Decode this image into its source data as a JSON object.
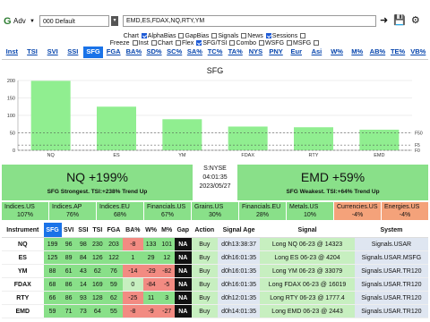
{
  "toolbar": {
    "adv_label": "Adv",
    "preset_value": "000 Default",
    "symbols_value": "EMD,ES,FDAX,NQ,RTY,YM",
    "icons": [
      "arrow-right-icon",
      "save-icon",
      "gear-icon"
    ]
  },
  "options": {
    "row1": [
      {
        "label": "Chart",
        "checked": true
      },
      {
        "label": "AlphaBias",
        "checked": false
      },
      {
        "label": "GapBias",
        "checked": false
      },
      {
        "label": "Signals",
        "checked": false
      },
      {
        "label": "News",
        "checked": true
      },
      {
        "label": "Sessions",
        "checked": false
      }
    ],
    "row2": [
      {
        "label": "Freeze",
        "checked": false
      },
      {
        "label": "Inst",
        "checked": false
      },
      {
        "label": "Chart",
        "checked": false
      },
      {
        "label": "Flex",
        "checked": true
      },
      {
        "label": "SFG/TSI",
        "checked": false
      },
      {
        "label": "Combo",
        "checked": false
      },
      {
        "label": "WSFG",
        "checked": false
      },
      {
        "label": "MSFG",
        "checked": false
      }
    ]
  },
  "tabs": [
    "Inst",
    "TSI",
    "SVI",
    "SSI",
    "SFG",
    "FGA",
    "BA%",
    "SD%",
    "SC%",
    "SA%",
    "TC%",
    "TA%",
    "NYS",
    "PNY",
    "Eur",
    "Asi",
    "W%",
    "M%",
    "AB%",
    "TE%",
    "VB%"
  ],
  "active_tab": "SFG",
  "chart_data": {
    "type": "bar",
    "title": "SFG",
    "categories": [
      "NQ",
      "ES",
      "YM",
      "FDAX",
      "RTY",
      "EMD"
    ],
    "values": [
      199,
      125,
      89,
      68,
      66,
      59
    ],
    "ylim": [
      0,
      200
    ],
    "yticks": [
      0,
      50,
      100,
      150,
      200
    ],
    "reference_lines": [
      {
        "label": "F0",
        "value": 0
      },
      {
        "label": "F5",
        "value": 15
      },
      {
        "label": "F50",
        "value": 50
      }
    ],
    "bar_color": "#90ee90"
  },
  "panels": {
    "left": {
      "big": "NQ +199%",
      "small": "SFG Strongest. TSI:+238% Trend Up"
    },
    "center": {
      "line1": "S:NYSE",
      "line2": "04:01:35",
      "line3": "2023/05/27"
    },
    "right": {
      "big": "EMD +59%",
      "small": "SFG Weakest. TSI:+64% Trend Up"
    }
  },
  "sectors": [
    {
      "name": "Indices.US",
      "pct": "107%",
      "color": "#89e089"
    },
    {
      "name": "Indices.AP",
      "pct": "76%",
      "color": "#89e089"
    },
    {
      "name": "Indices.EU",
      "pct": "68%",
      "color": "#89e089"
    },
    {
      "name": "Financials.US",
      "pct": "67%",
      "color": "#89e089"
    },
    {
      "name": "Grains.US",
      "pct": "30%",
      "color": "#89e089"
    },
    {
      "name": "Financials.EU",
      "pct": "28%",
      "color": "#89e089"
    },
    {
      "name": "Metals.US",
      "pct": "10%",
      "color": "#89e089"
    },
    {
      "name": "Currencies.US",
      "pct": "-4%",
      "color": "#f4a27a"
    },
    {
      "name": "Energies.US",
      "pct": "-4%",
      "color": "#f4a27a"
    }
  ],
  "table": {
    "headers": [
      "Instrument",
      "SFG",
      "SVI",
      "SSI",
      "TSI",
      "FGA",
      "BA%",
      "W%",
      "M%",
      "Gap",
      "Action",
      "Signal Age",
      "Signal",
      "System"
    ],
    "rows": [
      {
        "inst": "NQ",
        "sfg": "199",
        "svi": "96",
        "ssi": "98",
        "tsi": "230",
        "fga": "203",
        "ba": "-8",
        "w": "133",
        "m": "101",
        "gap": "NA",
        "action": "Buy",
        "age": "d0h13:38:37",
        "signal": "Long NQ 06-23 @ 14323",
        "system": "Signals.USAR"
      },
      {
        "inst": "ES",
        "sfg": "125",
        "svi": "89",
        "ssi": "84",
        "tsi": "126",
        "fga": "122",
        "ba": "1",
        "w": "29",
        "m": "12",
        "gap": "NA",
        "action": "Buy",
        "age": "d0h16:01:35",
        "signal": "Long ES 06-23 @ 4204",
        "system": "Signals.USAR.MSFG"
      },
      {
        "inst": "YM",
        "sfg": "88",
        "svi": "61",
        "ssi": "43",
        "tsi": "62",
        "fga": "76",
        "ba": "-14",
        "w": "-29",
        "m": "-82",
        "gap": "NA",
        "action": "Buy",
        "age": "d0h16:01:35",
        "signal": "Long YM 06-23 @ 33079",
        "system": "Signals.USAR.TR120"
      },
      {
        "inst": "FDAX",
        "sfg": "68",
        "svi": "86",
        "ssi": "14",
        "tsi": "169",
        "fga": "59",
        "ba": "0",
        "w": "-84",
        "m": "-5",
        "gap": "NA",
        "action": "Buy",
        "age": "d0h16:01:35",
        "signal": "Long FDAX 06-23 @ 16019",
        "system": "Signals.USAR.TR120"
      },
      {
        "inst": "RTY",
        "sfg": "66",
        "svi": "86",
        "ssi": "93",
        "tsi": "128",
        "fga": "62",
        "ba": "-25",
        "w": "11",
        "m": "3",
        "gap": "NA",
        "action": "Buy",
        "age": "d0h12:01:35",
        "signal": "Long RTY 06-23 @ 1777.4",
        "system": "Signals.USAR.TR120"
      },
      {
        "inst": "EMD",
        "sfg": "59",
        "svi": "71",
        "ssi": "73",
        "tsi": "64",
        "fga": "55",
        "ba": "-8",
        "w": "-9",
        "m": "-27",
        "gap": "NA",
        "action": "Buy",
        "age": "d0h14:01:35",
        "signal": "Long EMD 06-23 @ 2443",
        "system": "Signals.USAR.TR120"
      }
    ]
  }
}
